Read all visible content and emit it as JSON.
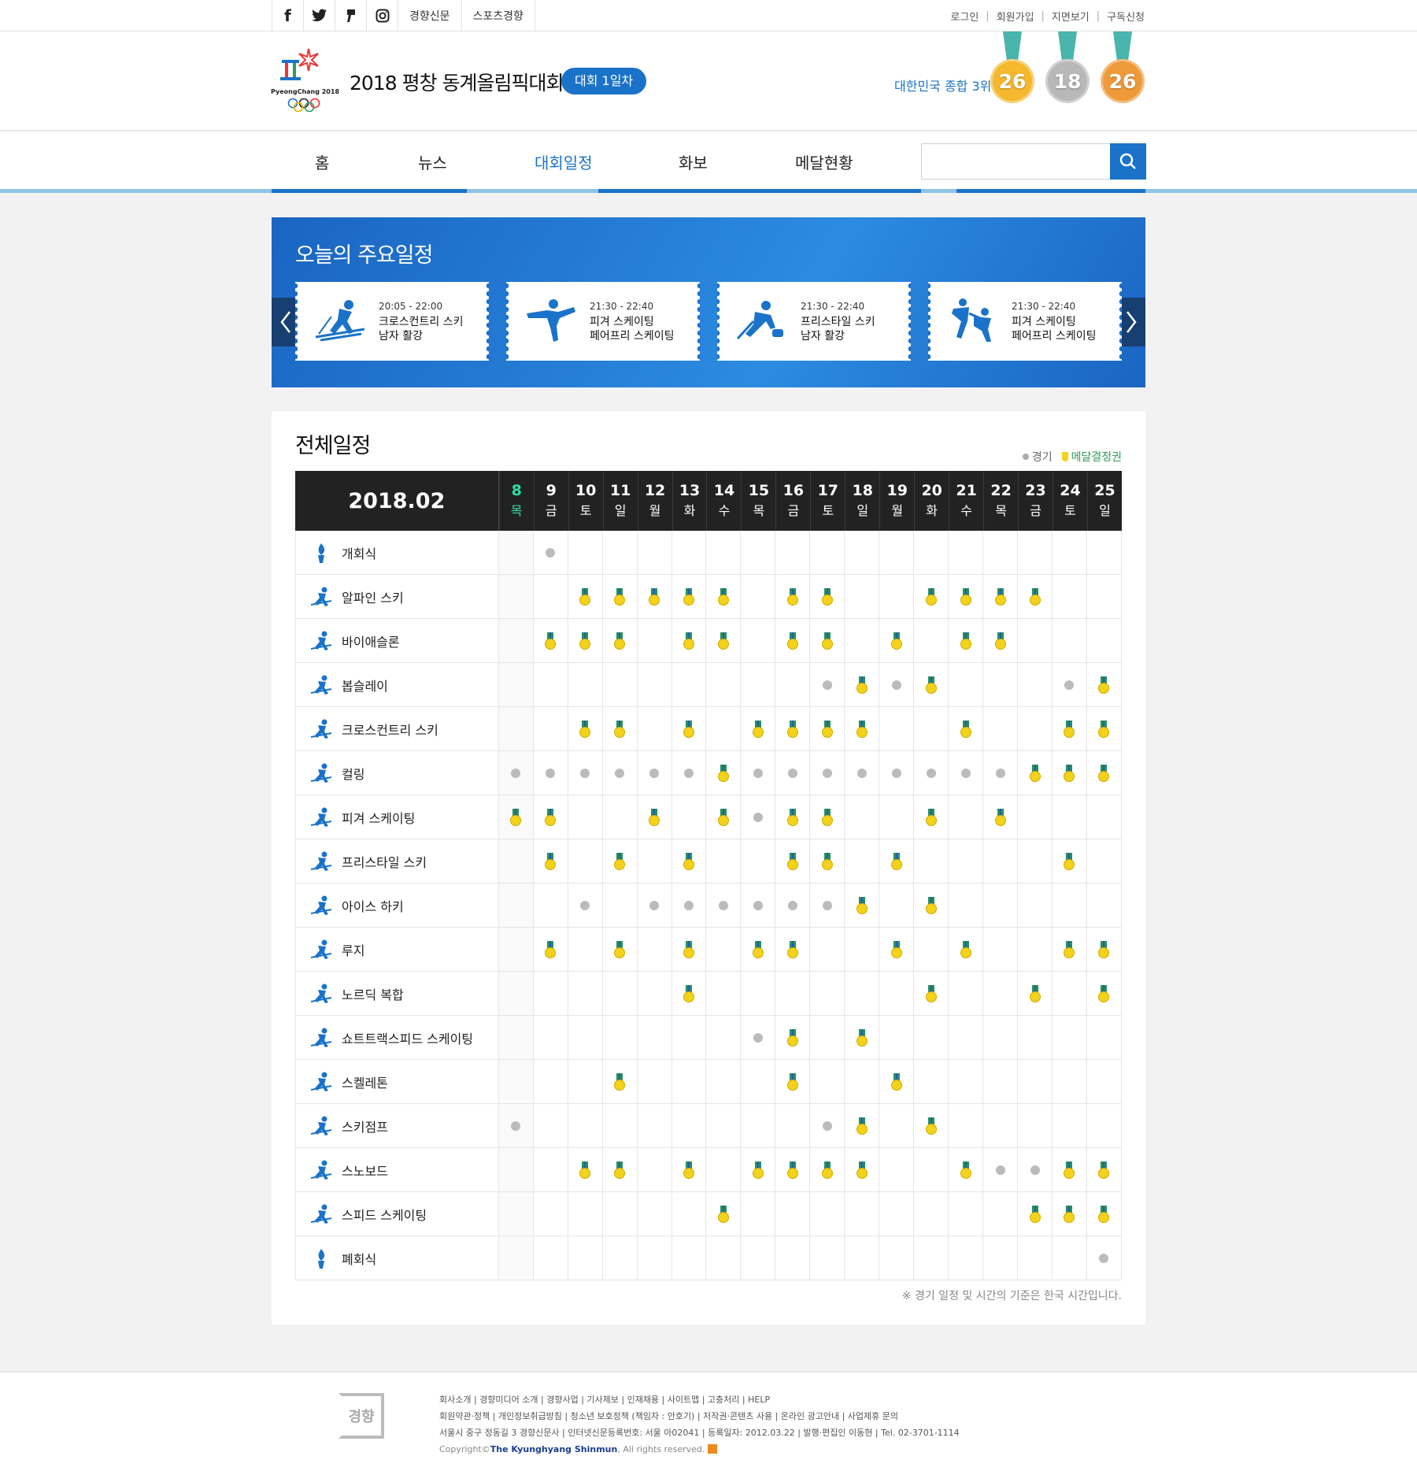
{
  "topbar": {
    "social": [
      "f",
      "t",
      "s",
      "i"
    ],
    "links": [
      "경향신문",
      "스포츠경향"
    ],
    "util": [
      "로그인",
      "회원가입",
      "지면보기",
      "구독신청"
    ]
  },
  "header": {
    "logo_text": "PyeongChang 2018",
    "title": "2018 평창 동계올림픽대회",
    "day_badge": "대회 1일차",
    "rank": "대한민국 종합 3위",
    "medals": {
      "gold": "26",
      "silver": "18",
      "bronze": "26"
    },
    "medal_colors": {
      "gold": "#f5b82e",
      "silver": "#b8b8b8",
      "bronze": "#ee9a3a"
    }
  },
  "nav": {
    "items": [
      "홈",
      "뉴스",
      "대회일정",
      "화보",
      "메달현황"
    ],
    "active": "대회일정",
    "search_placeholder": ""
  },
  "today": {
    "title": "오늘의 주요일정",
    "cards": [
      {
        "time": "20:05 - 22:00",
        "event": "크로스컨트리 스키",
        "detail": "남자 활강",
        "icon": "cross-country-ski-icon"
      },
      {
        "time": "21:30 - 22:40",
        "event": "피겨 스케이팅",
        "detail": "페어프리 스케이팅",
        "icon": "figure-skating-icon"
      },
      {
        "time": "21:30 - 22:40",
        "event": "프리스타일 스키",
        "detail": "남자 활강",
        "icon": "curling-icon"
      },
      {
        "time": "21:30 - 22:40",
        "event": "피겨 스케이팅",
        "detail": "페어프리 스케이팅",
        "icon": "pair-skating-icon"
      }
    ]
  },
  "schedule": {
    "title": "전체일정",
    "legend": {
      "game": "경기",
      "medal": "메달결정권"
    },
    "month": "2018.02",
    "days": [
      {
        "d": "8",
        "w": "목"
      },
      {
        "d": "9",
        "w": "금"
      },
      {
        "d": "10",
        "w": "토"
      },
      {
        "d": "11",
        "w": "일"
      },
      {
        "d": "12",
        "w": "월"
      },
      {
        "d": "13",
        "w": "화"
      },
      {
        "d": "14",
        "w": "수"
      },
      {
        "d": "15",
        "w": "목"
      },
      {
        "d": "16",
        "w": "금"
      },
      {
        "d": "17",
        "w": "토"
      },
      {
        "d": "18",
        "w": "일"
      },
      {
        "d": "19",
        "w": "월"
      },
      {
        "d": "20",
        "w": "화"
      },
      {
        "d": "21",
        "w": "수"
      },
      {
        "d": "22",
        "w": "목"
      },
      {
        "d": "23",
        "w": "금"
      },
      {
        "d": "24",
        "w": "토"
      },
      {
        "d": "25",
        "w": "일"
      }
    ],
    "rows": [
      {
        "sport": "개회식",
        "icon": "torch-icon",
        "cells": [
          "",
          "g",
          "",
          "",
          "",
          "",
          "",
          "",
          "",
          "",
          "",
          "",
          "",
          "",
          "",
          "",
          "",
          ""
        ]
      },
      {
        "sport": "알파인 스키",
        "icon": "alpine-ski-icon",
        "cells": [
          "",
          "",
          "m",
          "m",
          "m",
          "m",
          "m",
          "",
          "m",
          "m",
          "",
          "",
          "m",
          "m",
          "m",
          "m",
          "",
          ""
        ]
      },
      {
        "sport": "바이애슬론",
        "icon": "biathlon-icon",
        "cells": [
          "",
          "m",
          "m",
          "m",
          "",
          "m",
          "m",
          "",
          "m",
          "m",
          "",
          "m",
          "",
          "m",
          "m",
          "",
          "",
          ""
        ]
      },
      {
        "sport": "봅슬레이",
        "icon": "bobsleigh-icon",
        "cells": [
          "",
          "",
          "",
          "",
          "",
          "",
          "",
          "",
          "",
          "g",
          "m",
          "g",
          "m",
          "",
          "",
          "",
          "g",
          "m"
        ]
      },
      {
        "sport": "크로스컨트리 스키",
        "icon": "cross-country-icon",
        "cells": [
          "",
          "",
          "m",
          "m",
          "",
          "m",
          "",
          "m",
          "m",
          "m",
          "m",
          "",
          "",
          "m",
          "",
          "",
          "m",
          "m"
        ]
      },
      {
        "sport": "컬링",
        "icon": "curling-icon",
        "cells": [
          "g",
          "g",
          "g",
          "g",
          "g",
          "g",
          "m",
          "g",
          "g",
          "g",
          "g",
          "g",
          "g",
          "g",
          "g",
          "m",
          "m",
          "m"
        ]
      },
      {
        "sport": "피겨 스케이팅",
        "icon": "figure-skating-icon",
        "cells": [
          "m",
          "m",
          "",
          "",
          "m",
          "",
          "m",
          "g",
          "m",
          "m",
          "",
          "",
          "m",
          "",
          "m",
          "",
          "",
          ""
        ]
      },
      {
        "sport": "프리스타일 스키",
        "icon": "freestyle-ski-icon",
        "cells": [
          "",
          "m",
          "",
          "m",
          "",
          "m",
          "",
          "",
          "m",
          "m",
          "",
          "m",
          "",
          "",
          "",
          "",
          "m",
          ""
        ]
      },
      {
        "sport": "아이스 하키",
        "icon": "ice-hockey-icon",
        "cells": [
          "",
          "",
          "g",
          "",
          "g",
          "g",
          "g",
          "g",
          "g",
          "g",
          "m",
          "",
          "m",
          "",
          "",
          "",
          "",
          ""
        ]
      },
      {
        "sport": "루지",
        "icon": "luge-icon",
        "cells": [
          "",
          "m",
          "",
          "m",
          "",
          "m",
          "",
          "m",
          "m",
          "",
          "",
          "m",
          "",
          "m",
          "",
          "",
          "m",
          "m"
        ]
      },
      {
        "sport": "노르딕 복합",
        "icon": "nordic-combined-icon",
        "cells": [
          "",
          "",
          "",
          "",
          "",
          "m",
          "",
          "",
          "",
          "",
          "",
          "",
          "m",
          "",
          "",
          "m",
          "",
          "m"
        ]
      },
      {
        "sport": "쇼트트랙스피드 스케이팅",
        "icon": "short-track-icon",
        "cells": [
          "",
          "",
          "",
          "",
          "",
          "",
          "",
          "g",
          "m",
          "",
          "m",
          "",
          "",
          "",
          "",
          "",
          "",
          ""
        ]
      },
      {
        "sport": "스켈레톤",
        "icon": "skeleton-icon",
        "cells": [
          "",
          "",
          "",
          "m",
          "",
          "",
          "",
          "",
          "m",
          "",
          "",
          "m",
          "",
          "",
          "",
          "",
          "",
          ""
        ]
      },
      {
        "sport": "스키점프",
        "icon": "ski-jump-icon",
        "cells": [
          "g",
          "",
          "",
          "",
          "",
          "",
          "",
          "",
          "",
          "g",
          "m",
          "",
          "m",
          "",
          "",
          "",
          "",
          ""
        ]
      },
      {
        "sport": "스노보드",
        "icon": "snowboard-icon",
        "cells": [
          "",
          "",
          "m",
          "m",
          "",
          "m",
          "",
          "m",
          "m",
          "m",
          "m",
          "",
          "",
          "m",
          "g",
          "g",
          "m",
          "m"
        ]
      },
      {
        "sport": "스피드 스케이팅",
        "icon": "speed-skating-icon",
        "cells": [
          "",
          "",
          "",
          "",
          "",
          "",
          "m",
          "",
          "",
          "",
          "",
          "",
          "",
          "",
          "",
          "m",
          "m",
          "m"
        ]
      },
      {
        "sport": "폐회식",
        "icon": "torch-icon",
        "cells": [
          "",
          "",
          "",
          "",
          "",
          "",
          "",
          "",
          "",
          "",
          "",
          "",
          "",
          "",
          "",
          "",
          "",
          "g"
        ]
      }
    ],
    "note": "※ 경기 일정 및 시간의 기준은 한국 시간입니다."
  },
  "footer": {
    "logo": "경향",
    "line1": "회사소개 | 경향미디어 소개 | 경향사업 | 기사제보 | 인재채용 | 사이트맵 | 고충처리 | HELP",
    "line2": "회원약관·정책 | 개인정보취급방침 | 청소년 보호정책 (책임자 : 안호기) | 저작권·콘텐츠 사용 | 온라인 광고안내 | 사업제휴 문의",
    "line3": "서울시 중구 정동길 3 경향신문사 | 인터넷신문등록번호: 서울 아02041 | 등록일자: 2012.03.22 | 발행·편집인 이동현 | Tel. 02-3701-1114",
    "copy_pre": "Copyright©",
    "copy_name": "The Kyunghyang Shinmun",
    "copy_post": ", All rights reserved."
  }
}
